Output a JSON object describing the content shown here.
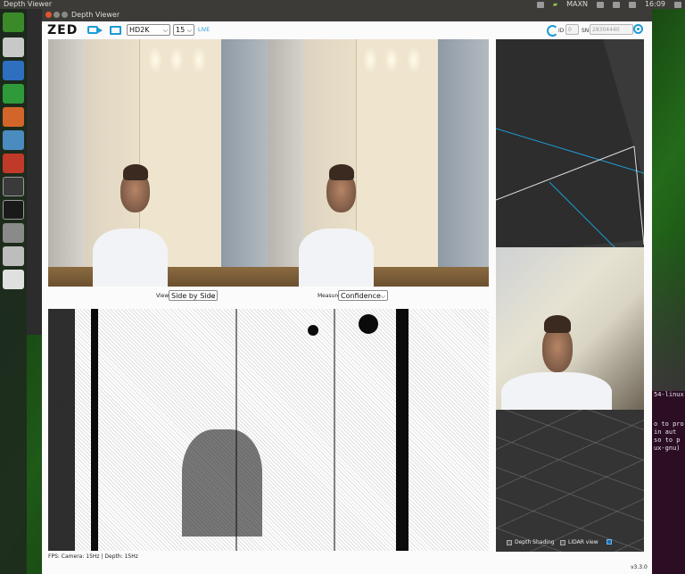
{
  "desktop": {
    "top_bar": {
      "app_title": "Depth Viewer",
      "nvidia_label": "MAXN",
      "clock": "16:09"
    },
    "terminal_lines": [
      "54-linux",
      "",
      "",
      "",
      "o to pro",
      "in aut",
      "",
      "so to p",
      "ux-gnu)"
    ]
  },
  "window": {
    "title": "Depth Viewer",
    "toolbar": {
      "logo": "ZED",
      "resolution": "HD2K",
      "fps": "15",
      "live_label": "LIVE",
      "id_label": "ID",
      "id_value": "0",
      "sn_label": "SN",
      "sn_value": "28304440"
    },
    "left_view": {
      "view_label": "View",
      "view_value": "Side by Side",
      "measure_label": "Measure",
      "measure_value": "Confidence"
    },
    "point_cloud": {
      "depth_shading_label": "Depth Shading",
      "depth_shading_checked": false,
      "lidar_view_label": "LIDAR view",
      "lidar_view_checked": false,
      "third_checked": true
    },
    "footer": {
      "fps_text": "FPS: Camera: 15Hz | Depth: 15Hz",
      "version": "v3.3.0"
    },
    "colors": {
      "accent": "#1d9bd6",
      "titlebar": "#3c3b37"
    }
  }
}
